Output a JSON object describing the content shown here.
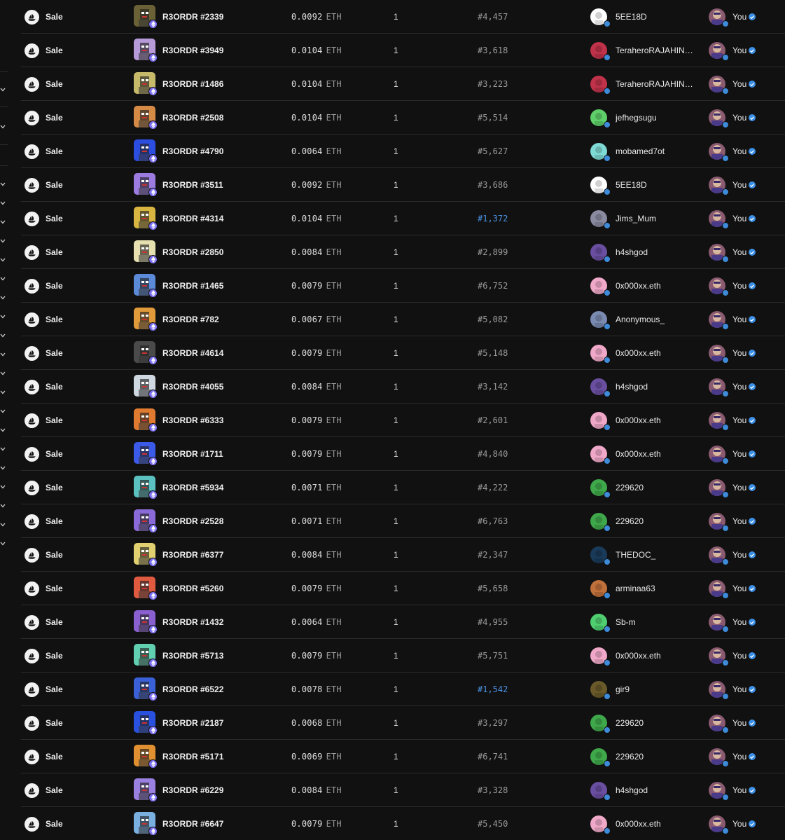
{
  "event_type_icon": "opensea-sale-icon",
  "currency_icon": "ethereum-icon",
  "verified_icon": "verified-check-icon",
  "colors": {
    "background": "#111111",
    "divider": "#2b2b2b",
    "rank_highlight": "#4a90e2",
    "muted": "#9a9a9a",
    "eth_badge": "#7b6ff0"
  },
  "rows": [
    {
      "type": "Sale",
      "item": "R3ORDR #2339",
      "price": "0.0092",
      "currency": "ETH",
      "qty": "1",
      "rank": "#4,457",
      "rank_highlight": false,
      "from": "5EE18D",
      "to": "You",
      "thumb_color": "#6b6136",
      "from_avatar_color": "#ffffff"
    },
    {
      "type": "Sale",
      "item": "R3ORDR #3949",
      "price": "0.0104",
      "currency": "ETH",
      "qty": "1",
      "rank": "#3,618",
      "rank_highlight": false,
      "from": "TeraheroRAJAHINDU...",
      "to": "You",
      "thumb_color": "#b79ad8",
      "from_avatar_color": "#c0324a"
    },
    {
      "type": "Sale",
      "item": "R3ORDR #1486",
      "price": "0.0104",
      "currency": "ETH",
      "qty": "1",
      "rank": "#3,223",
      "rank_highlight": false,
      "from": "TeraheroRAJAHINDU...",
      "to": "You",
      "thumb_color": "#c7b96a",
      "from_avatar_color": "#c0324a"
    },
    {
      "type": "Sale",
      "item": "R3ORDR #2508",
      "price": "0.0104",
      "currency": "ETH",
      "qty": "1",
      "rank": "#5,514",
      "rank_highlight": false,
      "from": "jefhegsugu",
      "to": "You",
      "thumb_color": "#d58a45",
      "from_avatar_color": "#5fcf69"
    },
    {
      "type": "Sale",
      "item": "R3ORDR #4790",
      "price": "0.0064",
      "currency": "ETH",
      "qty": "1",
      "rank": "#5,627",
      "rank_highlight": false,
      "from": "mobamed7ot",
      "to": "You",
      "thumb_color": "#2b4de0",
      "from_avatar_color": "#7fd9d4"
    },
    {
      "type": "Sale",
      "item": "R3ORDR #3511",
      "price": "0.0092",
      "currency": "ETH",
      "qty": "1",
      "rank": "#3,686",
      "rank_highlight": false,
      "from": "5EE18D",
      "to": "You",
      "thumb_color": "#9b7be0",
      "from_avatar_color": "#ffffff"
    },
    {
      "type": "Sale",
      "item": "R3ORDR #4314",
      "price": "0.0104",
      "currency": "ETH",
      "qty": "1",
      "rank": "#1,372",
      "rank_highlight": true,
      "from": "Jims_Mum",
      "to": "You",
      "thumb_color": "#d8b440",
      "from_avatar_color": "#8a8aa0"
    },
    {
      "type": "Sale",
      "item": "R3ORDR #2850",
      "price": "0.0084",
      "currency": "ETH",
      "qty": "1",
      "rank": "#2,899",
      "rank_highlight": false,
      "from": "h4shgod",
      "to": "You",
      "thumb_color": "#e6e0b0",
      "from_avatar_color": "#6a4fa0"
    },
    {
      "type": "Sale",
      "item": "R3ORDR #1465",
      "price": "0.0079",
      "currency": "ETH",
      "qty": "1",
      "rank": "#6,752",
      "rank_highlight": false,
      "from": "0x000xx.eth",
      "to": "You",
      "thumb_color": "#5a8ad8",
      "from_avatar_color": "#f0a8c8"
    },
    {
      "type": "Sale",
      "item": "R3ORDR #782",
      "price": "0.0067",
      "currency": "ETH",
      "qty": "1",
      "rank": "#5,082",
      "rank_highlight": false,
      "from": "Anonymous_",
      "to": "You",
      "thumb_color": "#e09a3a",
      "from_avatar_color": "#7a8ab0"
    },
    {
      "type": "Sale",
      "item": "R3ORDR #4614",
      "price": "0.0079",
      "currency": "ETH",
      "qty": "1",
      "rank": "#5,148",
      "rank_highlight": false,
      "from": "0x000xx.eth",
      "to": "You",
      "thumb_color": "#4a4a4a",
      "from_avatar_color": "#f0a8c8"
    },
    {
      "type": "Sale",
      "item": "R3ORDR #4055",
      "price": "0.0084",
      "currency": "ETH",
      "qty": "1",
      "rank": "#3,142",
      "rank_highlight": false,
      "from": "h4shgod",
      "to": "You",
      "thumb_color": "#cfd8e0",
      "from_avatar_color": "#6a4fa0"
    },
    {
      "type": "Sale",
      "item": "R3ORDR #6333",
      "price": "0.0079",
      "currency": "ETH",
      "qty": "1",
      "rank": "#2,601",
      "rank_highlight": false,
      "from": "0x000xx.eth",
      "to": "You",
      "thumb_color": "#e07a30",
      "from_avatar_color": "#f0a8c8"
    },
    {
      "type": "Sale",
      "item": "R3ORDR #1711",
      "price": "0.0079",
      "currency": "ETH",
      "qty": "1",
      "rank": "#4,840",
      "rank_highlight": false,
      "from": "0x000xx.eth",
      "to": "You",
      "thumb_color": "#3c5ae8",
      "from_avatar_color": "#f0a8c8"
    },
    {
      "type": "Sale",
      "item": "R3ORDR #5934",
      "price": "0.0071",
      "currency": "ETH",
      "qty": "1",
      "rank": "#4,222",
      "rank_highlight": false,
      "from": "229620",
      "to": "You",
      "thumb_color": "#5ac0c0",
      "from_avatar_color": "#3fa84a"
    },
    {
      "type": "Sale",
      "item": "R3ORDR #2528",
      "price": "0.0071",
      "currency": "ETH",
      "qty": "1",
      "rank": "#6,763",
      "rank_highlight": false,
      "from": "229620",
      "to": "You",
      "thumb_color": "#8a6ad8",
      "from_avatar_color": "#3fa84a"
    },
    {
      "type": "Sale",
      "item": "R3ORDR #6377",
      "price": "0.0084",
      "currency": "ETH",
      "qty": "1",
      "rank": "#2,347",
      "rank_highlight": false,
      "from": "THEDOC_",
      "to": "You",
      "thumb_color": "#e0d070",
      "from_avatar_color": "#1a3a5a"
    },
    {
      "type": "Sale",
      "item": "R3ORDR #5260",
      "price": "0.0079",
      "currency": "ETH",
      "qty": "1",
      "rank": "#5,658",
      "rank_highlight": false,
      "from": "arminaa63",
      "to": "You",
      "thumb_color": "#e05a40",
      "from_avatar_color": "#c0703a"
    },
    {
      "type": "Sale",
      "item": "R3ORDR #1432",
      "price": "0.0064",
      "currency": "ETH",
      "qty": "1",
      "rank": "#4,955",
      "rank_highlight": false,
      "from": "Sb-m",
      "to": "You",
      "thumb_color": "#8a60d0",
      "from_avatar_color": "#4fcf70"
    },
    {
      "type": "Sale",
      "item": "R3ORDR #5713",
      "price": "0.0079",
      "currency": "ETH",
      "qty": "1",
      "rank": "#5,751",
      "rank_highlight": false,
      "from": "0x000xx.eth",
      "to": "You",
      "thumb_color": "#60d0b0",
      "from_avatar_color": "#f0a8c8"
    },
    {
      "type": "Sale",
      "item": "R3ORDR #6522",
      "price": "0.0078",
      "currency": "ETH",
      "qty": "1",
      "rank": "#1,542",
      "rank_highlight": true,
      "from": "gir9",
      "to": "You",
      "thumb_color": "#3a60d8",
      "from_avatar_color": "#6a5a2a"
    },
    {
      "type": "Sale",
      "item": "R3ORDR #2187",
      "price": "0.0068",
      "currency": "ETH",
      "qty": "1",
      "rank": "#3,297",
      "rank_highlight": false,
      "from": "229620",
      "to": "You",
      "thumb_color": "#2a50e0",
      "from_avatar_color": "#3fa84a"
    },
    {
      "type": "Sale",
      "item": "R3ORDR #5171",
      "price": "0.0069",
      "currency": "ETH",
      "qty": "1",
      "rank": "#6,741",
      "rank_highlight": false,
      "from": "229620",
      "to": "You",
      "thumb_color": "#e09030",
      "from_avatar_color": "#3fa84a"
    },
    {
      "type": "Sale",
      "item": "R3ORDR #6229",
      "price": "0.0084",
      "currency": "ETH",
      "qty": "1",
      "rank": "#3,328",
      "rank_highlight": false,
      "from": "h4shgod",
      "to": "You",
      "thumb_color": "#9a80e0",
      "from_avatar_color": "#6a4fa0"
    },
    {
      "type": "Sale",
      "item": "R3ORDR #6647",
      "price": "0.0079",
      "currency": "ETH",
      "qty": "1",
      "rank": "#5,450",
      "rank_highlight": false,
      "from": "0x000xx.eth",
      "to": "You",
      "thumb_color": "#7ab0e0",
      "from_avatar_color": "#f0a8c8"
    }
  ]
}
